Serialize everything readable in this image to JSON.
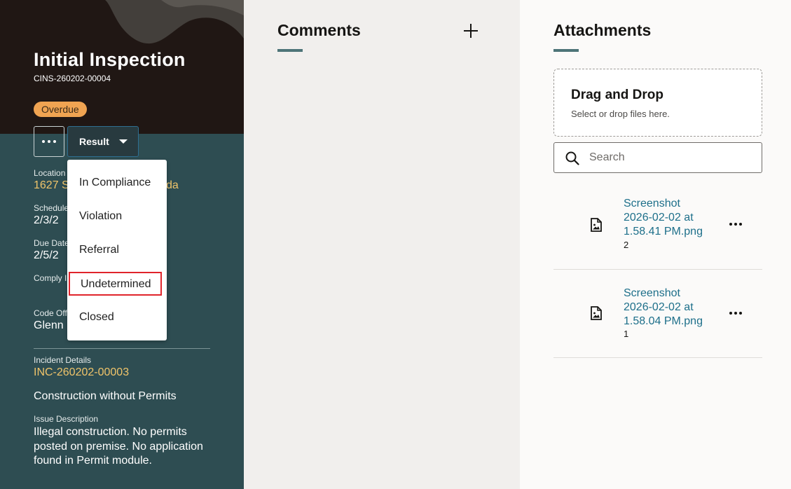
{
  "record": {
    "title": "Initial Inspection",
    "id": "CINS-260202-00004",
    "status": "Overdue",
    "result_label": "Result"
  },
  "fields": {
    "location_label": "Location",
    "location_value": "1627 S",
    "location_value_tail": "da",
    "scheduled_label": "Schedule",
    "scheduled_value": "2/3/2",
    "due_label": "Due Date",
    "due_value": "2/5/2",
    "comply_label": "Comply I",
    "officer_label": "Code Off",
    "officer_value": "Glenn",
    "incident_label": "Incident Details",
    "incident_value": "INC-260202-00003",
    "incident_type": "Construction without Permits",
    "issue_label": "Issue Description",
    "issue_value": "Illegal construction. No permits posted on premise. No application found in Permit module."
  },
  "result_menu": {
    "items": [
      "In Compliance",
      "Violation",
      "Referral",
      "Undetermined",
      "Closed"
    ],
    "highlighted": "Undetermined"
  },
  "comments": {
    "title": "Comments"
  },
  "attachments": {
    "title": "Attachments",
    "drop_title": "Drag and Drop",
    "drop_subtitle": "Select or drop files here.",
    "search_placeholder": "Search",
    "items": [
      {
        "name": "Screenshot 2026-02-02 at 1.58.41 PM.png",
        "line1": "Screenshot",
        "line2": "2026-02-02 at",
        "line3": "1.58.41 PM.png",
        "count": "2"
      },
      {
        "name": "Screenshot 2026-02-02 at 1.58.04 PM.png",
        "line1": "Screenshot",
        "line2": "2026-02-02 at",
        "line3": "1.58.04 PM.png",
        "count": "1"
      }
    ]
  },
  "colors": {
    "panel": "#2e4d52",
    "hero": "#201714",
    "badge": "#f0a452",
    "link_gold": "#f0c46a",
    "link_teal": "#1d6f8a",
    "highlight": "#e0242b"
  }
}
